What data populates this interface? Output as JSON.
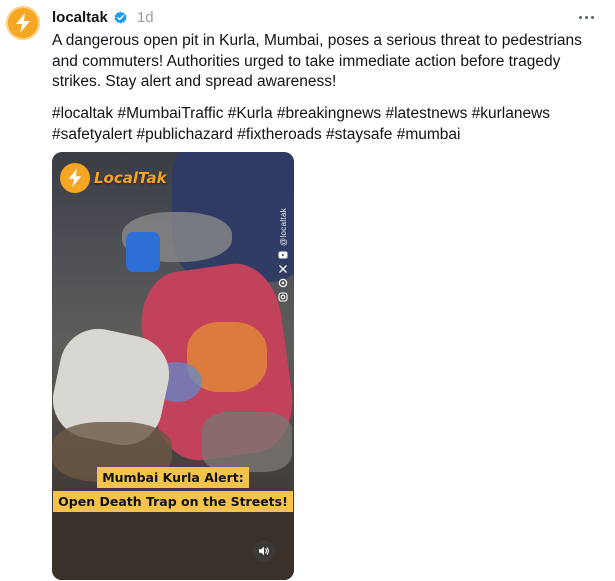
{
  "post": {
    "username": "localtak",
    "verified": true,
    "timestamp": "1d",
    "more_icon": "more-horizontal-icon",
    "text": "A dangerous open pit in Kurla, Mumbai, poses a serious threat to pedestrians and commuters! Authorities urged to take immediate action before tragedy strikes. Stay alert and spread awareness!",
    "hashtags": [
      "#localtak",
      "#MumbaiTraffic",
      "#Kurla",
      "#breakingnews",
      "#latestnews",
      "#kurlanews",
      "#safetyalert",
      "#publichazard",
      "#fixtheroads",
      "#staysafe",
      "#mumbai"
    ]
  },
  "video": {
    "logo_text": "LocalTak",
    "handle": "@localtak",
    "caption_line1": "Mumbai Kurla Alert:",
    "caption_line2": "Open Death Trap on the Streets!",
    "rail_icons": [
      "youtube-icon",
      "x-icon",
      "threads-icon",
      "instagram-icon"
    ],
    "mute_icon": "speaker-icon"
  },
  "colors": {
    "brand": "#f5a623",
    "verified": "#1d9bf0",
    "caption_bg": "#f5c24a",
    "muted_text": "#9aa0a6"
  }
}
